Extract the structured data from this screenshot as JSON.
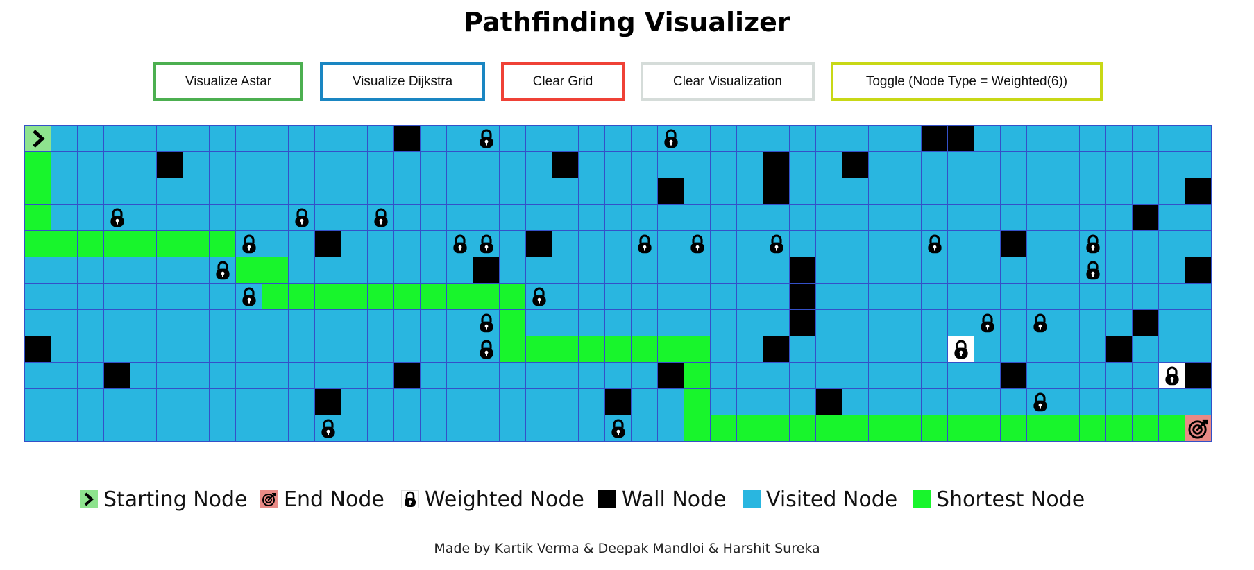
{
  "header": {
    "title": "Pathfinding Visualizer"
  },
  "toolbar": {
    "buttons": [
      {
        "label": "Visualize Astar",
        "color": "#4caf50"
      },
      {
        "label": "Visualize Dijkstra",
        "color": "#1a86c2"
      },
      {
        "label": "Clear Grid",
        "color": "#ef4136"
      },
      {
        "label": "Clear Visualization",
        "color": "#d5dcd9"
      },
      {
        "label": "Toggle (Node Type = Weighted(6))",
        "color": "#c8d816"
      }
    ]
  },
  "colors": {
    "visited": "#29b6e0",
    "shortest": "#18f52c",
    "wall": "#000000",
    "start": "#8ee38e",
    "end": "#e88a86",
    "grid_line": "#3450c8"
  },
  "grid": {
    "rows": 12,
    "cols": 45,
    "legend_codes": "S=start E=end W=weighted(visited) U=weighted(not visited) #=wall P=shortest path .=visited",
    "map": [
      "S.............#..W......W.........##.........",
      "P....#..............#.......#..#.............",
      "P.......................#...#...............#",
      "P..W......W..W............................#..",
      "PPPPPPPPW..#....WW.#...W.W..W.....W..#..W....",
      ".......WPP.......#...........#..........W...#",
      "........WPPPPPPPPPPW.........#...............",
      ".................WP..........#......W.W...#..",
      "#................WPPPPPPPP..#......U.....#...",
      "...#..........#.........#P...........#.....U#",
      "...........#..........#..P....#.......W......",
      "...........W..........W..PPPPPPPPPPPPPPPPPPPE"
    ]
  },
  "legend": {
    "items": [
      {
        "label": "Starting Node",
        "icon": "chevron-right-icon"
      },
      {
        "label": "End Node",
        "icon": "target-icon"
      },
      {
        "label": "Weighted Node",
        "icon": "lock-icon"
      },
      {
        "label": "Wall Node",
        "icon": "wall-swatch"
      },
      {
        "label": "Visited Node",
        "icon": "visited-swatch"
      },
      {
        "label": "Shortest Node",
        "icon": "shortest-swatch"
      }
    ]
  },
  "footer": {
    "credit": "Made by Kartik Verma & Deepak Mandloi & Harshit Sureka"
  }
}
